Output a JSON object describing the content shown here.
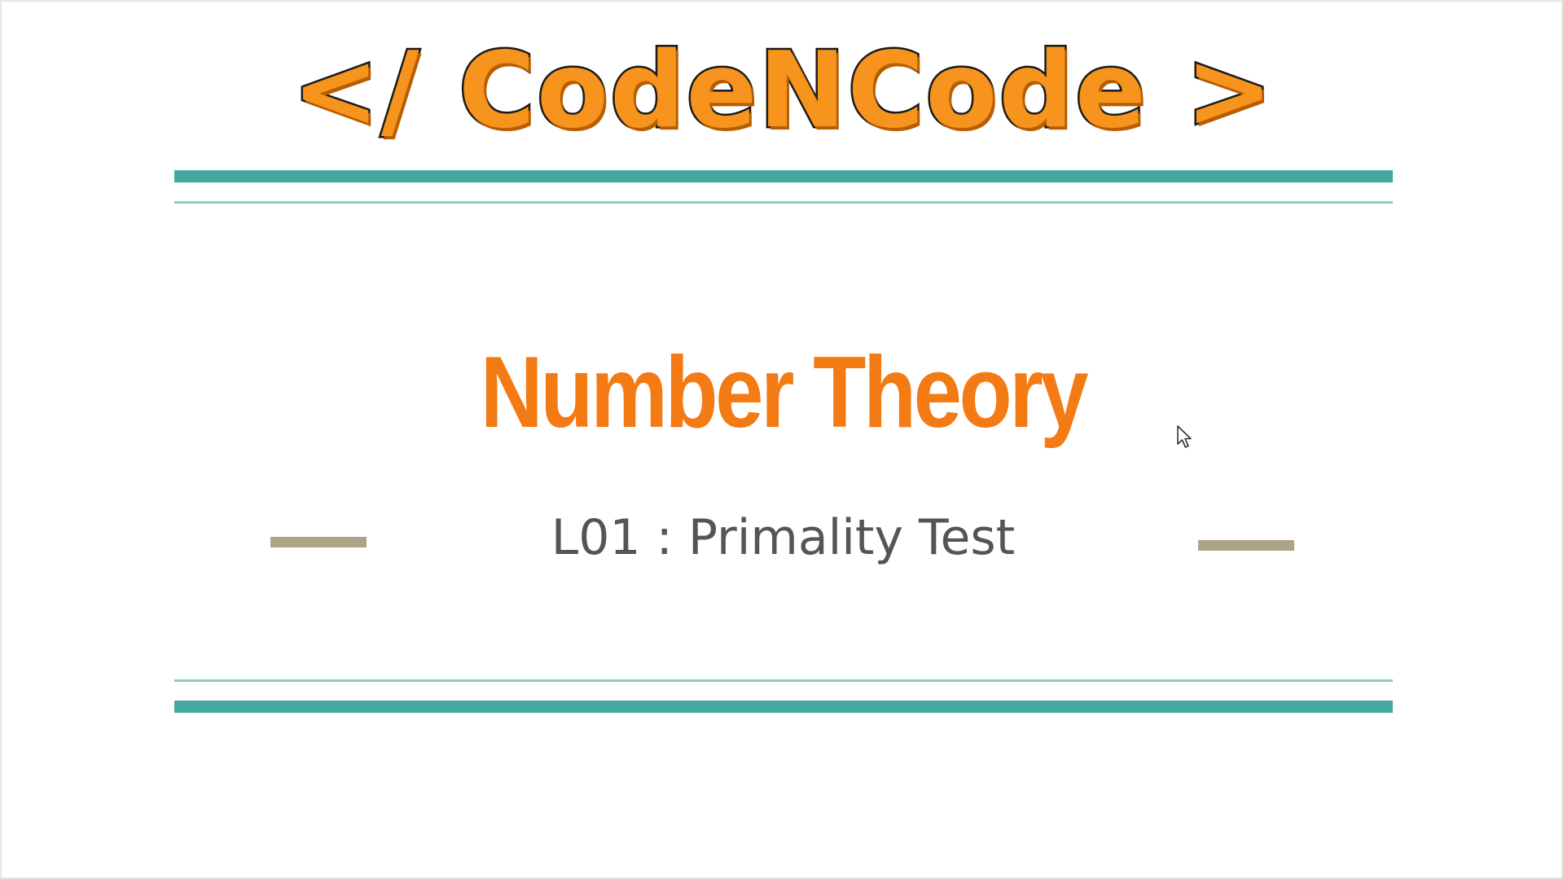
{
  "slide": {
    "logo_text": "</ CodeNCode >",
    "title": "Number Theory",
    "subtitle": "L01 : Primality Test"
  },
  "colors": {
    "accent_orange": "#f47a14",
    "logo_orange": "#f7941d",
    "rule_teal": "#45a8a0",
    "rule_teal_light": "#8ccbc5",
    "dash_khaki": "#aba487",
    "subtitle_gray": "#555555"
  },
  "icons": {
    "cursor": "mouse-pointer-icon"
  }
}
